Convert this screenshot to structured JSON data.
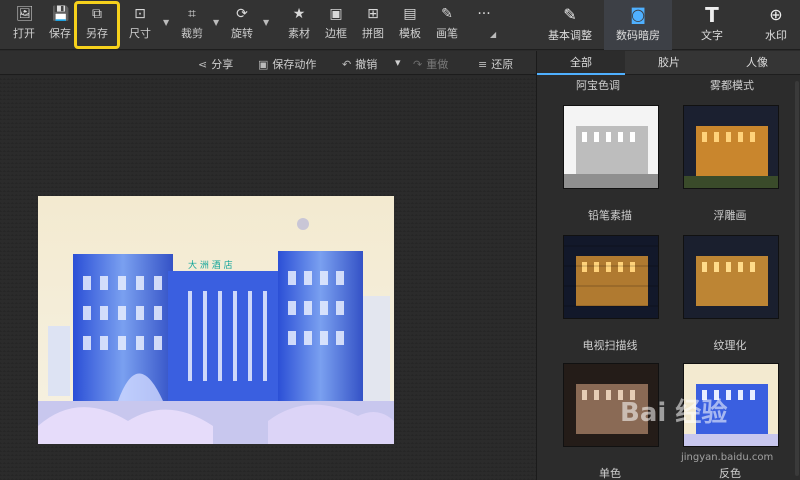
{
  "toolbar": {
    "items": [
      {
        "label": "打开",
        "icon": "open-icon"
      },
      {
        "label": "保存",
        "icon": "save-icon"
      },
      {
        "label": "另存",
        "icon": "save-as-icon"
      },
      {
        "label": "尺寸",
        "icon": "resize-icon"
      },
      {
        "label": "裁剪",
        "icon": "crop-icon"
      },
      {
        "label": "旋转",
        "icon": "rotate-icon"
      },
      {
        "label": "素材",
        "icon": "material-icon"
      },
      {
        "label": "边框",
        "icon": "border-icon"
      },
      {
        "label": "拼图",
        "icon": "collage-icon"
      },
      {
        "label": "模板",
        "icon": "template-icon"
      },
      {
        "label": "画笔",
        "icon": "brush-icon"
      }
    ],
    "more": "···"
  },
  "right_tabs": [
    {
      "label": "基本调整",
      "icon": "adjust-icon"
    },
    {
      "label": "数码暗房",
      "icon": "camera-icon"
    },
    {
      "label": "文字",
      "icon": "text-icon"
    },
    {
      "label": "水印",
      "icon": "watermark-icon"
    }
  ],
  "subbar": {
    "share": "分享",
    "save_action": "保存动作",
    "undo": "撤销",
    "redo": "重做",
    "restore": "还原"
  },
  "filter_tabs": [
    "全部",
    "胶片",
    "人像"
  ],
  "top_labels": [
    "阿宝色调",
    "雾都模式"
  ],
  "effects": [
    {
      "label": "铅笔素描"
    },
    {
      "label": "浮雕画"
    },
    {
      "label": "电视扫描线"
    },
    {
      "label": "纹理化"
    },
    {
      "label": "单色"
    },
    {
      "label": "反色"
    }
  ],
  "photo_sign": "大 洲 酒 店",
  "watermark": {
    "brand": "Bai 经验",
    "url": "jingyan.baidu.com"
  },
  "colors": {
    "accent": "#4fb0ff",
    "highlight": "#f6d11c"
  }
}
